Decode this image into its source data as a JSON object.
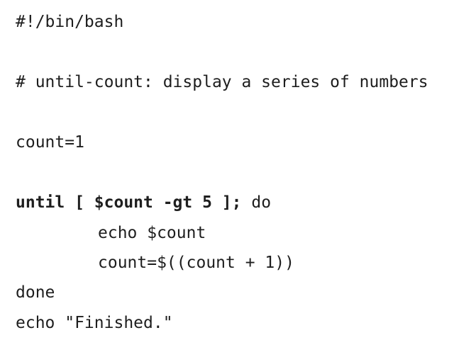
{
  "code": {
    "shebang": "#!/bin/bash",
    "comment": "# until-count: display a series of numbers",
    "assign": "count=1",
    "until_bold": "until [ $count -gt 5 ];",
    "until_do": " do",
    "echo_count": "echo $count",
    "increment": "count=$((count + 1))",
    "done": "done",
    "echo_finished": "echo \"Finished.\""
  }
}
